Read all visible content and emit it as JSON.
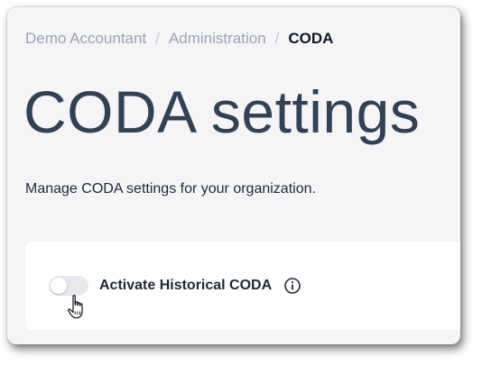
{
  "breadcrumb": {
    "items": [
      "Demo Accountant",
      "Administration"
    ],
    "separator": "/",
    "current": "CODA"
  },
  "page": {
    "title": "CODA settings",
    "description": "Manage CODA settings for your organization."
  },
  "settings": {
    "historical_coda": {
      "label": "Activate Historical CODA",
      "enabled": false,
      "info_icon": "info-circle-icon"
    }
  },
  "cursor": {
    "icon": "hand-pointer-icon"
  },
  "colors": {
    "page_background": "#f5f5f8",
    "card_background": "#ffffff",
    "title": "#334155",
    "breadcrumb_muted": "#9aa3b2",
    "toggle_off": "#e7e9ee"
  }
}
